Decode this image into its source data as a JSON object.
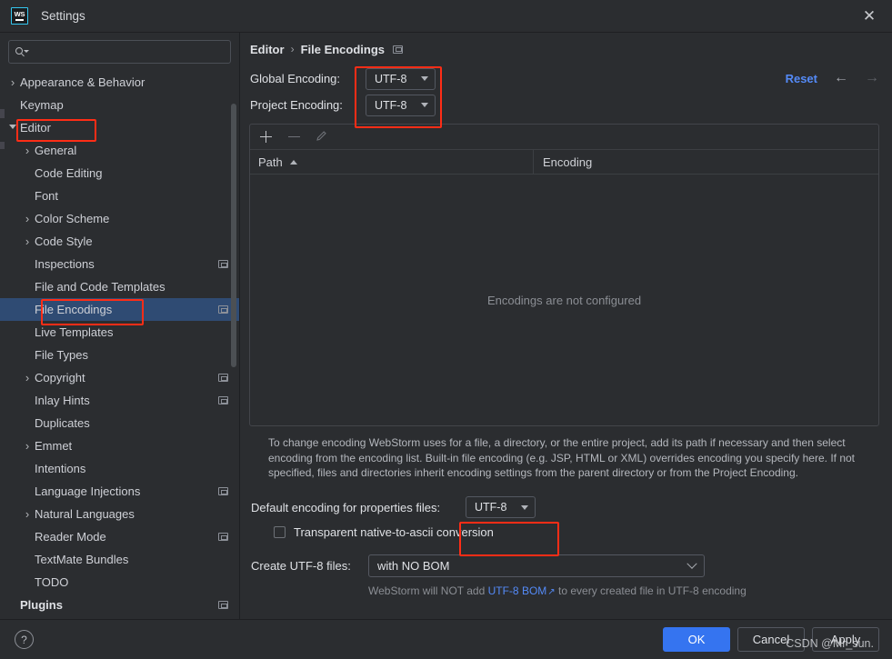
{
  "window": {
    "title": "Settings",
    "app_icon": "webstorm-logo",
    "close_label": "✕"
  },
  "search": {
    "placeholder": "",
    "value": "",
    "icon": "search-icon"
  },
  "sidebar": {
    "items": [
      {
        "label": "Appearance & Behavior",
        "level": 0,
        "arrow": "collapsed",
        "cfg": false,
        "selected": false,
        "bold": false
      },
      {
        "label": "Keymap",
        "level": 0,
        "arrow": "none",
        "cfg": false,
        "selected": false,
        "bold": false
      },
      {
        "label": "Editor",
        "level": 0,
        "arrow": "expanded",
        "cfg": false,
        "selected": false,
        "bold": false
      },
      {
        "label": "General",
        "level": 1,
        "arrow": "collapsed",
        "cfg": false,
        "selected": false,
        "bold": false
      },
      {
        "label": "Code Editing",
        "level": 1,
        "arrow": "none",
        "cfg": false,
        "selected": false,
        "bold": false
      },
      {
        "label": "Font",
        "level": 1,
        "arrow": "none",
        "cfg": false,
        "selected": false,
        "bold": false
      },
      {
        "label": "Color Scheme",
        "level": 1,
        "arrow": "collapsed",
        "cfg": false,
        "selected": false,
        "bold": false
      },
      {
        "label": "Code Style",
        "level": 1,
        "arrow": "collapsed",
        "cfg": false,
        "selected": false,
        "bold": false
      },
      {
        "label": "Inspections",
        "level": 1,
        "arrow": "none",
        "cfg": true,
        "selected": false,
        "bold": false
      },
      {
        "label": "File and Code Templates",
        "level": 1,
        "arrow": "none",
        "cfg": false,
        "selected": false,
        "bold": false
      },
      {
        "label": "File Encodings",
        "level": 1,
        "arrow": "none",
        "cfg": true,
        "selected": true,
        "bold": false
      },
      {
        "label": "Live Templates",
        "level": 1,
        "arrow": "none",
        "cfg": false,
        "selected": false,
        "bold": false
      },
      {
        "label": "File Types",
        "level": 1,
        "arrow": "none",
        "cfg": false,
        "selected": false,
        "bold": false
      },
      {
        "label": "Copyright",
        "level": 1,
        "arrow": "collapsed",
        "cfg": true,
        "selected": false,
        "bold": false
      },
      {
        "label": "Inlay Hints",
        "level": 1,
        "arrow": "none",
        "cfg": true,
        "selected": false,
        "bold": false
      },
      {
        "label": "Duplicates",
        "level": 1,
        "arrow": "none",
        "cfg": false,
        "selected": false,
        "bold": false
      },
      {
        "label": "Emmet",
        "level": 1,
        "arrow": "collapsed",
        "cfg": false,
        "selected": false,
        "bold": false
      },
      {
        "label": "Intentions",
        "level": 1,
        "arrow": "none",
        "cfg": false,
        "selected": false,
        "bold": false
      },
      {
        "label": "Language Injections",
        "level": 1,
        "arrow": "none",
        "cfg": true,
        "selected": false,
        "bold": false
      },
      {
        "label": "Natural Languages",
        "level": 1,
        "arrow": "collapsed",
        "cfg": false,
        "selected": false,
        "bold": false
      },
      {
        "label": "Reader Mode",
        "level": 1,
        "arrow": "none",
        "cfg": true,
        "selected": false,
        "bold": false
      },
      {
        "label": "TextMate Bundles",
        "level": 1,
        "arrow": "none",
        "cfg": false,
        "selected": false,
        "bold": false
      },
      {
        "label": "TODO",
        "level": 1,
        "arrow": "none",
        "cfg": false,
        "selected": false,
        "bold": false
      },
      {
        "label": "Plugins",
        "level": 0,
        "arrow": "none",
        "cfg": true,
        "selected": false,
        "bold": true
      }
    ]
  },
  "main": {
    "breadcrumb": {
      "root": "Editor",
      "separator": "›",
      "leaf": "File Encodings"
    },
    "reset_label": "Reset",
    "nav_back": "←",
    "nav_forward": "→",
    "global_encoding": {
      "label": "Global Encoding:",
      "value": "UTF-8"
    },
    "project_encoding": {
      "label": "Project Encoding:",
      "value": "UTF-8"
    },
    "table": {
      "toolbar": {
        "add": "+",
        "remove": "−",
        "edit": "pencil-icon"
      },
      "columns": [
        "Path",
        "Encoding"
      ],
      "sort_column": "Path",
      "sort_direction": "ascending",
      "rows": [],
      "empty_message": "Encodings are not configured"
    },
    "description": "To change encoding WebStorm uses for a file, a directory, or the entire project, add its path if necessary and then select encoding from the encoding list. Built-in file encoding (e.g. JSP, HTML or XML) overrides encoding you specify here. If not specified, files and directories inherit encoding settings from the parent directory or from the Project Encoding.",
    "properties_encoding": {
      "label": "Default encoding for properties files:",
      "value": "UTF-8"
    },
    "transparent_conversion": {
      "label": "Transparent native-to-ascii conversion",
      "checked": false
    },
    "create_utf8": {
      "label": "Create UTF-8 files:",
      "value": "with NO BOM"
    },
    "bom_note": {
      "prefix": "WebStorm will NOT add ",
      "link": "UTF-8 BOM",
      "link_icon": "↗",
      "suffix": " to every created file in UTF-8 encoding"
    }
  },
  "footer": {
    "help": "?",
    "ok": "OK",
    "cancel": "Cancel",
    "apply": "Apply"
  },
  "watermark": "CSDN @Mr_sun.",
  "colors": {
    "background": "#2b2d30",
    "accent_blue": "#3574f0",
    "link_blue": "#548af7",
    "selection": "#2f4b73",
    "annotation_red": "#ff2d16",
    "logo_cyan": "#35c7f0"
  }
}
